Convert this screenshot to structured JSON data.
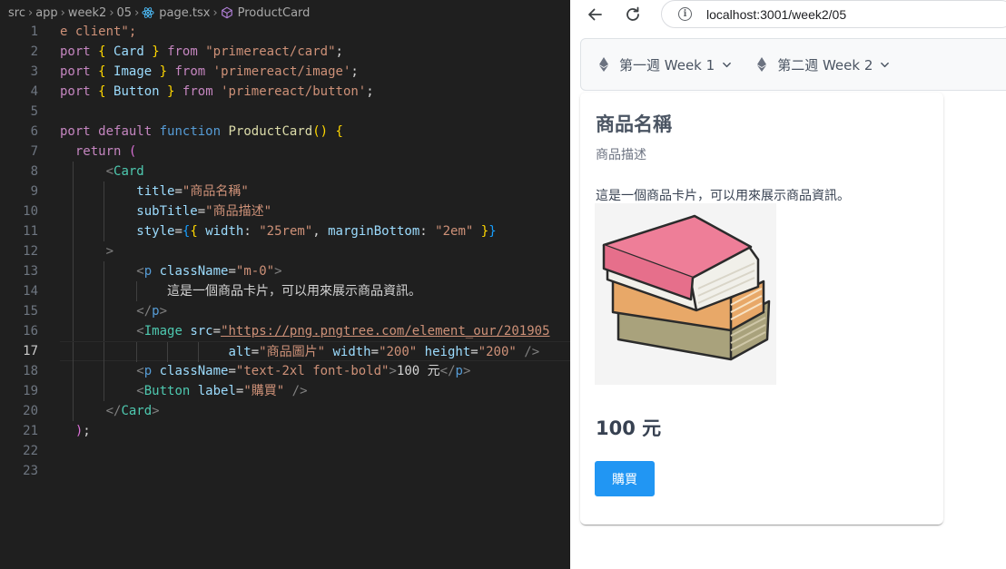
{
  "editor": {
    "breadcrumb": {
      "segments": [
        "src",
        "app",
        "week2",
        "05",
        "page.tsx",
        "ProductCard"
      ]
    },
    "line_numbers": [
      "1",
      "2",
      "3",
      "4",
      "5",
      "6",
      "7",
      "8",
      "9",
      "10",
      "11",
      "12",
      "13",
      "14",
      "15",
      "16",
      "17",
      "18",
      "19",
      "20",
      "21",
      "22",
      "23"
    ],
    "active_line": "17",
    "code": {
      "l1": "e client\";",
      "l2a": "port",
      "l2b": "Card",
      "l2c": "from",
      "l2d": "\"primereact/card\"",
      "l3a": "port",
      "l3b": "Image",
      "l3c": "from",
      "l3d": "'primereact/image'",
      "l4a": "port",
      "l4b": "Button",
      "l4c": "from",
      "l4d": "'primereact/button'",
      "l6a": "port",
      "l6b": "default",
      "l6c": "function",
      "l6d": "ProductCard",
      "l7": "return",
      "l8": "Card",
      "l9a": "title",
      "l9b": "\"商品名稱\"",
      "l10a": "subTitle",
      "l10b": "\"商品描述\"",
      "l11a": "style",
      "l11b": "width",
      "l11c": "\"25rem\"",
      "l11d": "marginBottom",
      "l11e": "\"2em\"",
      "l13a": "p",
      "l13b": "className",
      "l13c": "\"m-0\"",
      "l14": "這是一個商品卡片，可以用來展示商品資訊。",
      "l15": "p",
      "l16a": "Image",
      "l16b": "src",
      "l16c": "\"https://png.pngtree.com/element_our/201905",
      "l17a": "alt",
      "l17b": "\"商品圖片\"",
      "l17c": "width",
      "l17d": "\"200\"",
      "l17e": "height",
      "l17f": "\"200\"",
      "l18a": "p",
      "l18b": "className",
      "l18c": "\"text-2xl font-bold\"",
      "l18d": "100 元",
      "l18e": "p",
      "l19a": "Button",
      "l19b": "label",
      "l19c": "\"購買\"",
      "l20": "Card"
    }
  },
  "browser": {
    "url": "localhost:3001/week2/05",
    "menu": [
      {
        "label": "第一週 Week 1"
      },
      {
        "label": "第二週 Week 2"
      }
    ],
    "card": {
      "title": "商品名稱",
      "subtitle": "商品描述",
      "description": "這是一個商品卡片，可以用來展示商品資訊。",
      "image_alt": "商品圖片",
      "price": "100 元",
      "button_label": "購買"
    },
    "colors": {
      "button": "#2196f3",
      "menubar_bg": "#f8f9fa"
    }
  }
}
